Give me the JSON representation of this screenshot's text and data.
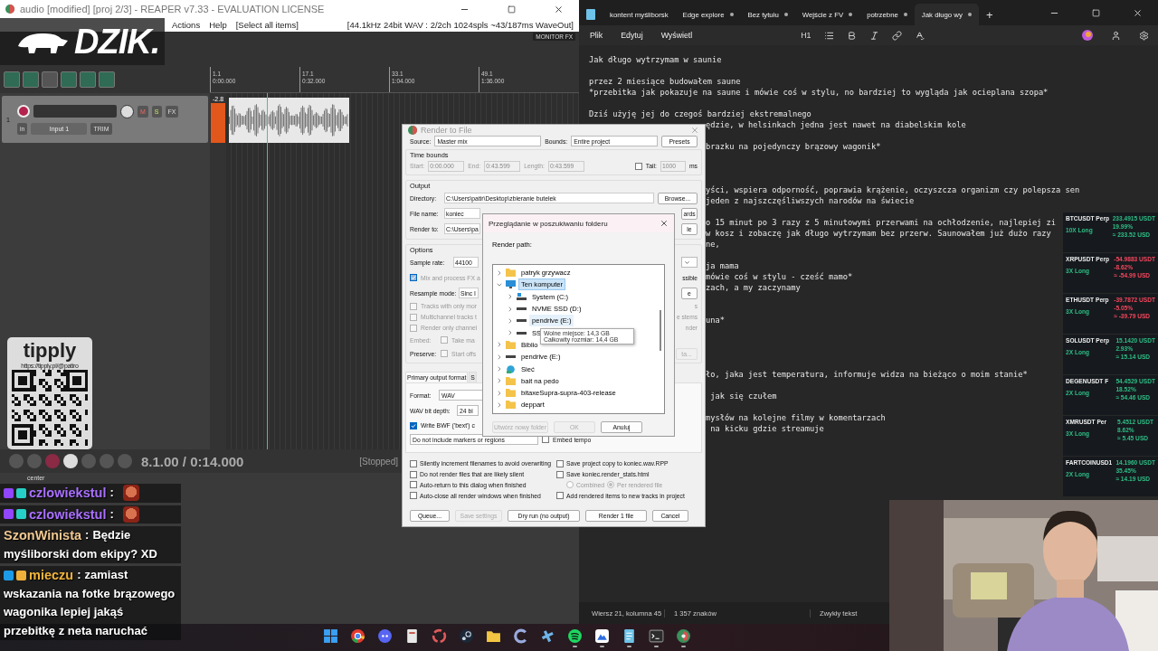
{
  "reaper": {
    "title": "audio [modified] [proj 2/3] - REAPER v7.33 - EVALUATION LICENSE",
    "menu": [
      {
        "label": "Actions"
      },
      {
        "label": "Help"
      },
      {
        "label": "[Select all items]"
      }
    ],
    "audio_status": "[44.1kHz 24bit WAV : 2/2ch 1024spls ~43/187ms WaveOut]",
    "monitor_fx": "MONITOR FX",
    "ruler": [
      {
        "bar": "1.1",
        "time": "0:00.000"
      },
      {
        "bar": "17.1",
        "time": "0:32.000"
      },
      {
        "bar": "33.1",
        "time": "1:04.000"
      },
      {
        "bar": "49.1",
        "time": "1:36.000"
      }
    ],
    "track": {
      "number": "1",
      "armed": true,
      "mute": "M",
      "solo": "S",
      "fx": "FX",
      "input_mode": "in",
      "input": "Input 1",
      "trim": "TRIM",
      "meter": "-2.8"
    },
    "transport": {
      "position": "8.1.00 / 0:14.000",
      "state": "[Stopped]"
    },
    "mixer": {
      "pan": "center"
    }
  },
  "render": {
    "title": "Render to File",
    "source_label": "Source:",
    "source": "Master mix",
    "bounds_label": "Bounds:",
    "bounds": "Entire project",
    "presets": "Presets",
    "time_bounds": {
      "title": "Time bounds",
      "start_label": "Start:",
      "start": "0:00.000",
      "end_label": "End:",
      "end": "0:43.599",
      "length_label": "Length:",
      "length": "0:43.599",
      "tail_label": "Tail:",
      "tail_checked": false,
      "tail": "1000",
      "tail_unit": "ms"
    },
    "output": {
      "title": "Output",
      "directory_label": "Directory:",
      "directory": "C:\\Users\\patir\\Desktop\\zbieranie butelek",
      "browse": "Browse...",
      "file_name_label": "File name:",
      "file_name": "koniec",
      "file_name_button": "ards",
      "render_to_label": "Render to:",
      "render_to": "C:\\Users\\pa",
      "render_to_button": "le"
    },
    "options": {
      "title": "Options",
      "sample_rate_label": "Sample rate:",
      "sample_rate": "44100",
      "mix_fx": {
        "label": "Mix and process FX a",
        "checked": true,
        "disabled": true
      },
      "mix_fx_right": "ssible",
      "resample_label": "Resample mode:",
      "resample": "Sinc I",
      "resample_button": "e",
      "checks": [
        {
          "label": "Tracks with only mor",
          "checked": false,
          "right": "s"
        },
        {
          "label": "Multichannel tracks t",
          "checked": false,
          "right": "e stems"
        },
        {
          "label": "Render only channel",
          "checked": false,
          "right": "nder"
        }
      ],
      "embed_label": "Embed:",
      "embed": {
        "label": "Take ma",
        "checked": false
      },
      "preserve_label": "Preserve:",
      "preserve": {
        "label": "Start offs",
        "checked": false
      },
      "preserve_button": "ta..."
    },
    "format_tabs": [
      {
        "label": "Primary output format",
        "selected": true
      },
      {
        "label": "S",
        "selected": false
      }
    ],
    "format": {
      "format_label": "Format:",
      "format": "WAV",
      "bit_depth_label": "WAV bit depth:",
      "bit_depth": "24 bi",
      "bwf": {
        "label": "Write BWF ('bext') c",
        "checked": true
      },
      "markers": "Do not include markers or regions",
      "embed_tempo": {
        "label": "Embed tempo",
        "checked": false
      }
    },
    "checks_left": [
      {
        "label": "Silently increment filenames to avoid overwriting",
        "checked": false
      },
      {
        "label": "Do not render files that are likely silent",
        "checked": false
      },
      {
        "label": "Auto-return to this dialog when finished",
        "checked": false
      },
      {
        "label": "Auto-close all render windows when finished",
        "checked": false
      }
    ],
    "checks_right": [
      {
        "label": "Save project copy to koniec.wav.RPP",
        "checked": false
      },
      {
        "label": "Save koniec.render_stats.html",
        "checked": false
      },
      {
        "label": "Add rendered items to new tracks in project",
        "checked": false
      }
    ],
    "stats_radios": [
      {
        "label": "Combined",
        "selected": false
      },
      {
        "label": "Per rendered file",
        "selected": true
      }
    ],
    "buttons": [
      {
        "label": "Queue...",
        "disabled": false
      },
      {
        "label": "Save settings",
        "disabled": true
      },
      {
        "label": "Dry run (no output)",
        "disabled": false
      },
      {
        "label": "Render 1 file",
        "disabled": false
      },
      {
        "label": "Cancel",
        "disabled": false
      }
    ]
  },
  "folder_dialog": {
    "title": "Przeglądanie w poszukiwaniu folderu",
    "prompt": "Render path:",
    "tree": [
      {
        "label": "patryk grzywacz",
        "kind": "folder",
        "expanded": false,
        "selected": false,
        "hovered": false
      },
      {
        "label": "Ten komputer",
        "kind": "computer",
        "expanded": true,
        "selected": true,
        "hovered": false,
        "children": [
          {
            "label": "System (C:)",
            "kind": "system",
            "expanded": false,
            "selected": false,
            "hovered": false
          },
          {
            "label": "NVME SSD (D:)",
            "kind": "drive",
            "expanded": false,
            "selected": false,
            "hovered": false
          },
          {
            "label": "pendrive (E:)",
            "kind": "drive",
            "expanded": false,
            "selected": false,
            "hovered": true
          },
          {
            "label": "SS",
            "kind": "drive",
            "expanded": false,
            "selected": false,
            "hovered": false
          }
        ]
      },
      {
        "label": "Biblio",
        "kind": "folder",
        "expanded": false,
        "selected": false,
        "hovered": false
      },
      {
        "label": "pendrive (E:)",
        "kind": "drive",
        "expanded": false,
        "selected": false,
        "hovered": false
      },
      {
        "label": "Sieć",
        "kind": "network",
        "expanded": false,
        "selected": false,
        "hovered": false
      },
      {
        "label": "bait na pedo",
        "kind": "folder",
        "expanded": false,
        "selected": false,
        "hovered": false
      },
      {
        "label": "bitaxeSupra-supra-403-release",
        "kind": "folder",
        "expanded": false,
        "selected": false,
        "hovered": false
      },
      {
        "label": "deppart",
        "kind": "folder",
        "expanded": false,
        "selected": false,
        "hovered": false
      }
    ],
    "tooltip": [
      "Wolne miejsce: 14,3 GB",
      "Całkowity rozmiar: 14,4 GB"
    ],
    "buttons": [
      {
        "label": "Utwórz nowy folder",
        "disabled": true
      },
      {
        "label": "OK",
        "disabled": true
      },
      {
        "label": "Anuluj",
        "disabled": false
      }
    ]
  },
  "notepad": {
    "tabs": [
      {
        "label": "kontent myśliborsk",
        "selected": false,
        "modified": false
      },
      {
        "label": "Edge explore",
        "selected": false,
        "modified": true
      },
      {
        "label": "Bez tytułu",
        "selected": false,
        "modified": true
      },
      {
        "label": "Wejście z FV",
        "selected": false,
        "modified": true
      },
      {
        "label": "potrzebne",
        "selected": false,
        "modified": true
      },
      {
        "label": "Jak długo wy",
        "selected": true,
        "modified": true
      }
    ],
    "add_tab": "+",
    "menu": [
      "Plik",
      "Edytuj",
      "Wyświetl"
    ],
    "heading": "H1",
    "lines": [
      {
        "kind": "full",
        "text": "Jak długo wytrzymam w saunie"
      },
      {
        "kind": "blank"
      },
      {
        "kind": "full",
        "text": "przez 2 miesiące budowałem saune"
      },
      {
        "kind": "full",
        "text": "*przebitka jak pokazuje na saune i mówie coś w stylu, no bardziej to wygląda jak ocieplana szopa*"
      },
      {
        "kind": "blank"
      },
      {
        "kind": "full",
        "text": "Dziś użyję jej do czegoś bardziej ekstremalnego"
      },
      {
        "kind": "tail",
        "text": "ędzie, w helsinkach jedna jest nawet na diabelskim kole"
      },
      {
        "kind": "blank"
      },
      {
        "kind": "tail",
        "text": "brazku na pojedynczy brązowy wagonik*"
      },
      {
        "kind": "blank"
      },
      {
        "kind": "blank"
      },
      {
        "kind": "blank"
      },
      {
        "kind": "tail",
        "text": "yści, wspiera odporność, poprawia krążenie, oczyszcza organizm czy polepsza sen"
      },
      {
        "kind": "tail",
        "text": "jeden z najszczęśliwszych narodów na świecie"
      },
      {
        "kind": "blank"
      },
      {
        "kind": "tail",
        "text": "o 15 minut po 3 razy z 5 minutowymi przerwami na ochłodzenie, najlepiej zi"
      },
      {
        "kind": "tail",
        "text": "w kosz i zobaczę jak długo wytrzymam bez przerw. Saunowałem już dużo razy"
      },
      {
        "kind": "tail",
        "text": "ne,"
      },
      {
        "kind": "blank"
      },
      {
        "kind": "tail",
        "text": "ja mama"
      },
      {
        "kind": "tail",
        "text": "mówie coś w stylu - cześć mamo*"
      },
      {
        "kind": "tail",
        "text": "zach, a my zaczynamy"
      },
      {
        "kind": "blank"
      },
      {
        "kind": "blank"
      },
      {
        "kind": "tail",
        "text": "una*"
      },
      {
        "kind": "blank"
      },
      {
        "kind": "blank"
      },
      {
        "kind": "blank"
      },
      {
        "kind": "blank"
      },
      {
        "kind": "tail",
        "text": "ło, jaka jest temperatura, informuje widza na bieżąco o moim stanie*"
      },
      {
        "kind": "blank"
      },
      {
        "kind": "tail",
        "text": " jak się czułem"
      },
      {
        "kind": "blank"
      },
      {
        "kind": "tail",
        "text": "mysłów na kolejne filmy w komentarzach"
      },
      {
        "kind": "tail",
        "text": " na kicku gdzie streamuje"
      }
    ],
    "status": [
      "Wiersz 21, kolumna 45",
      "1 357 znaków",
      "Zwykły tekst"
    ]
  },
  "ticker": [
    {
      "symbol": "BTCUSDT",
      "contract": "Perp",
      "leverage": "10X Long",
      "pnl": "233.4915 USDT",
      "percent": "19.99%",
      "usd": "≈ 233.52 USD",
      "positive": true
    },
    {
      "symbol": "XRPUSDT",
      "contract": "Perp",
      "leverage": "3X Long",
      "pnl": "-54.9883 USDT",
      "percent": "-8.62%",
      "usd": "≈ -54.99 USD",
      "positive": false
    },
    {
      "symbol": "ETHUSDT",
      "contract": "Perp",
      "leverage": "3X Long",
      "pnl": "-39.7872 USDT",
      "percent": "-5.05%",
      "usd": "≈ -39.79 USD",
      "positive": false
    },
    {
      "symbol": "SOLUSDT",
      "contract": "Perp",
      "leverage": "2X Long",
      "pnl": "15.1420 USDT",
      "percent": "2.93%",
      "usd": "≈ 15.14 USD",
      "positive": true
    },
    {
      "symbol": "DEGENUSDT",
      "contract": "F",
      "leverage": "2X Long",
      "pnl": "54.4529 USDT",
      "percent": "18.52%",
      "usd": "≈ 54.46 USD",
      "positive": true
    },
    {
      "symbol": "XMRUSDT",
      "contract": "Per",
      "leverage": "3X Long",
      "pnl": "5.4512 USDT",
      "percent": "8.62%",
      "usd": "≈ 5.45 USD",
      "positive": true
    },
    {
      "symbol": "FARTCOINUSD1",
      "leverage": "2X Long",
      "pnl": "14.1960 USDT",
      "percent": "35.45%",
      "usd": "≈ 14.19 USD",
      "positive": true
    }
  ],
  "overlay_logo": "DZIK.",
  "tipply": {
    "logo": "tipply",
    "url": "https://tipply.pl/@patiro"
  },
  "chat": [
    {
      "kind": "emote",
      "badges": [
        {
          "kind": "gem"
        },
        {
          "kind": "bits"
        }
      ],
      "user": "czlowiekstul",
      "color": "#a970ff",
      "separator": ":"
    },
    {
      "kind": "emote",
      "badges": [
        {
          "kind": "gem"
        },
        {
          "kind": "bits"
        }
      ],
      "user": "czlowiekstul",
      "color": "#a970ff",
      "separator": ":"
    },
    {
      "kind": "text",
      "user": "SzonWinista",
      "color": "#f0c890",
      "separator": ":",
      "lines": [
        "Będzie",
        "myśliborski dom ekipy? XD"
      ]
    },
    {
      "kind": "text",
      "badges": [
        {
          "kind": "mod"
        },
        {
          "kind": "crown"
        }
      ],
      "user": "mieczu",
      "color": "#f2b53a",
      "separator": ":",
      "lines": [
        "zamiast",
        "wskazania na fotke brązowego",
        "wagonika lepiej jakąś",
        "przebitkę z neta naruchać"
      ]
    }
  ],
  "taskbar": [
    {
      "kind": "start",
      "running": false
    },
    {
      "kind": "chrome",
      "running": false
    },
    {
      "kind": "discord",
      "running": false
    },
    {
      "kind": "doc",
      "running": false
    },
    {
      "kind": "swirl",
      "running": false
    },
    {
      "kind": "steam",
      "running": false
    },
    {
      "kind": "folder",
      "running": false
    },
    {
      "kind": "ccleaner",
      "running": false
    },
    {
      "kind": "tools",
      "running": false
    },
    {
      "kind": "spotify",
      "running": true
    },
    {
      "kind": "mountain",
      "running": true
    },
    {
      "kind": "notepad",
      "running": true
    },
    {
      "kind": "terminal",
      "running": true
    },
    {
      "kind": "reaper",
      "running": true
    }
  ]
}
